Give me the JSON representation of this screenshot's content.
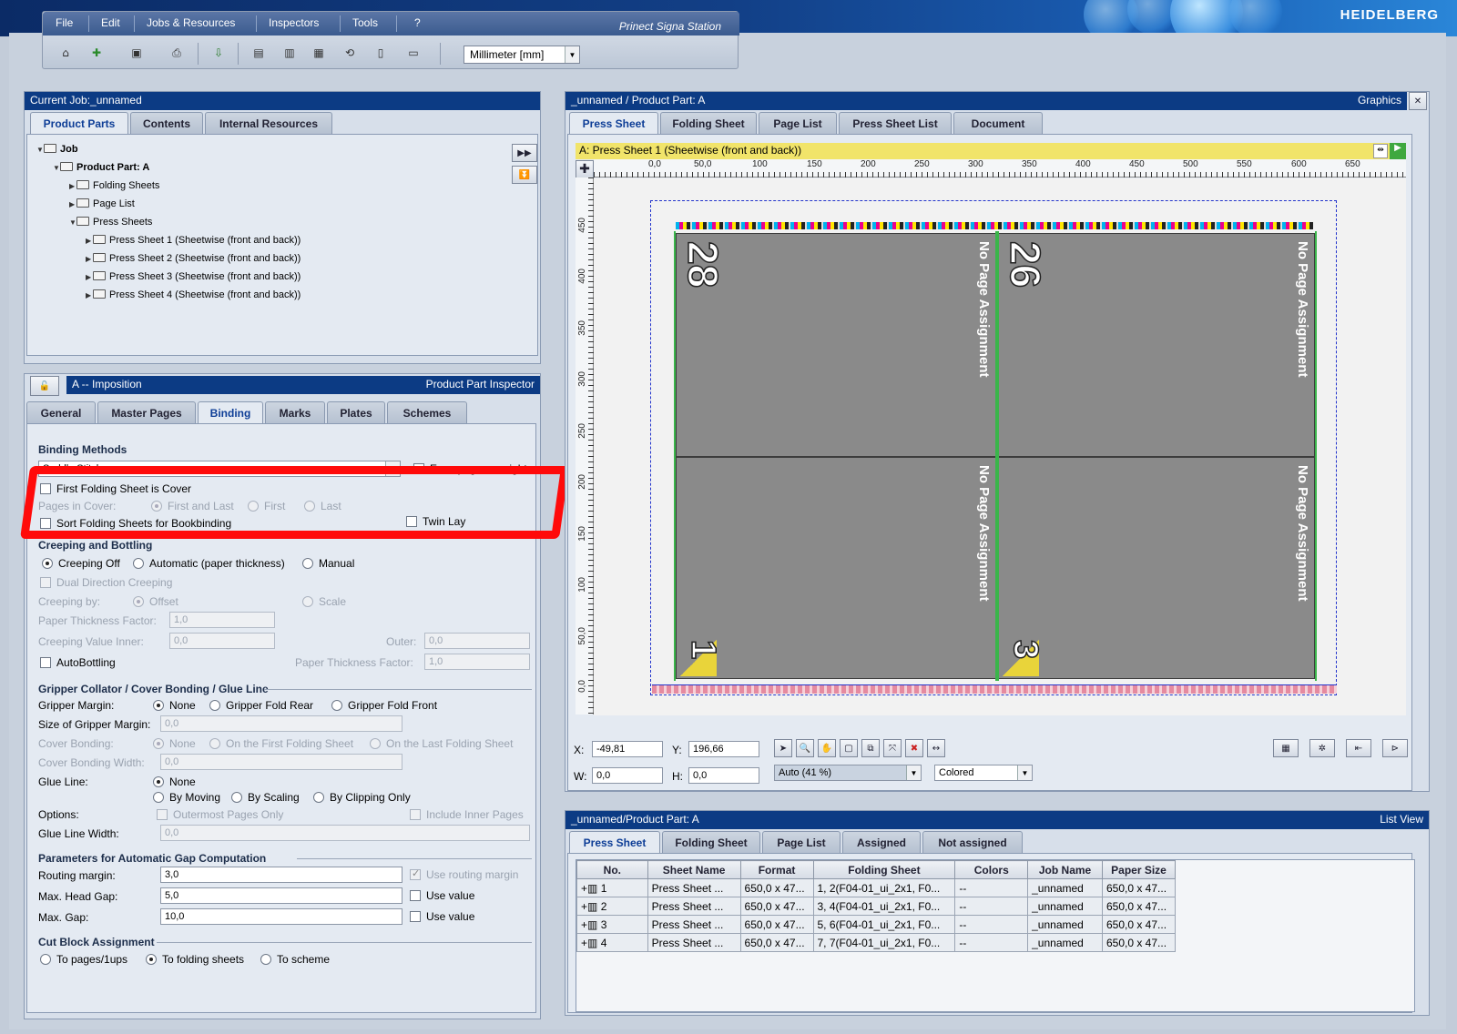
{
  "header": {
    "brand": "HEIDELBERG",
    "app_title": "Prinect Signa Station"
  },
  "menu": [
    "File",
    "Edit",
    "Jobs & Resources",
    "Inspectors",
    "Tools",
    "?"
  ],
  "toolbar": {
    "units": "Millimeter  [mm]"
  },
  "job_panel": {
    "title": "Current Job:_unnamed",
    "tabs": [
      "Product Parts",
      "Contents",
      "Internal Resources"
    ],
    "tree": {
      "job": "Job",
      "product_part": "Product Part: A",
      "folding_sheets": "Folding Sheets",
      "page_list": "Page List",
      "press_sheets": "Press Sheets",
      "sheets": [
        "Press Sheet 1 (Sheetwise (front and back))",
        "Press Sheet 2 (Sheetwise (front and back))",
        "Press Sheet 3 (Sheetwise (front and back))",
        "Press Sheet 4 (Sheetwise (front and back))"
      ]
    }
  },
  "inspector": {
    "title_left": "A -- Imposition",
    "title_right": "Product Part Inspector",
    "tabs": [
      "General",
      "Master Pages",
      "Binding",
      "Marks",
      "Plates",
      "Schemes"
    ],
    "binding_methods": "Binding Methods",
    "binding_value": "Saddle Stitch",
    "even_pages": "Even pages on right",
    "first_folding_cover": "First Folding Sheet is Cover",
    "pages_in_cover": "Pages in Cover:",
    "cover_opts": [
      "First and Last",
      "First",
      "Last"
    ],
    "sort_folding": "Sort Folding Sheets for Bookbinding",
    "twin_lay": "Twin Lay",
    "creeping_header": "Creeping and Bottling",
    "creeping_opts": [
      "Creeping Off",
      "Automatic (paper thickness)",
      "Manual"
    ],
    "dual_direction": "Dual Direction Creeping",
    "creeping_by": "Creeping by:",
    "creeping_by_opts": [
      "Offset",
      "Scale"
    ],
    "paper_thickness_factor": "Paper Thickness Factor:",
    "ptf_value": "1,0",
    "creeping_value_inner": "Creeping Value Inner:",
    "cvi_value": "0,0",
    "outer": "Outer:",
    "outer_value": "0,0",
    "autobottling": "AutoBottling",
    "ptf2_label": "Paper Thickness Factor:",
    "ptf2_value": "1,0",
    "gripper_header": "Gripper Collator / Cover Bonding / Glue Line",
    "gripper_margin": "Gripper Margin:",
    "gripper_opts": [
      "None",
      "Gripper Fold Rear",
      "Gripper Fold Front"
    ],
    "size_gripper": "Size of Gripper Margin:",
    "size_gripper_value": "0,0",
    "cover_bonding": "Cover Bonding:",
    "cover_bonding_opts": [
      "None",
      "On the First Folding Sheet",
      "On the Last Folding Sheet"
    ],
    "cover_bonding_width": "Cover Bonding Width:",
    "cbw_value": "0,0",
    "glue_line": "Glue Line:",
    "glue_opts": [
      "None",
      "By Moving",
      "By Scaling",
      "By Clipping Only"
    ],
    "options": "Options:",
    "outermost": "Outermost Pages Only",
    "include_inner": "Include Inner Pages",
    "glue_line_width": "Glue Line Width:",
    "glw_value": "0,0",
    "params_header": "Parameters for Automatic Gap Computation",
    "routing_margin": "Routing margin:",
    "routing_value": "3,0",
    "use_routing": "Use routing margin",
    "max_head_gap": "Max. Head Gap:",
    "mhg_value": "5,0",
    "use_value": "Use value",
    "max_gap": "Max. Gap:",
    "mg_value": "10,0",
    "use_value2": "Use value",
    "cut_header": "Cut Block Assignment",
    "cut_opts": [
      "To pages/1ups",
      "To folding sheets",
      "To scheme"
    ]
  },
  "graphics": {
    "title": "_unnamed / Product Part: A",
    "title_right": "Graphics",
    "tabs": [
      "Press Sheet",
      "Folding Sheet",
      "Page List",
      "Press Sheet List",
      "Document"
    ],
    "sheet_label": "A:  Press Sheet 1 (Sheetwise (front and back))",
    "ruler_x": [
      "0,0",
      "50,0",
      "100",
      "150",
      "200",
      "250",
      "300",
      "350",
      "400",
      "450",
      "500",
      "550",
      "600",
      "650"
    ],
    "ruler_y": [
      "450",
      "400",
      "350",
      "300",
      "250",
      "200",
      "150",
      "100",
      "50,0",
      "0,0"
    ],
    "pages": [
      {
        "num": "28",
        "label": "No Page Assignment"
      },
      {
        "num": "26",
        "label": "No Page Assignment"
      },
      {
        "num": "",
        "label": "No Page Assignment"
      },
      {
        "num": "",
        "label": "No Page Assignment"
      }
    ],
    "bottom_nums": [
      "1",
      "3"
    ],
    "x_label": "X:",
    "x_value": "-49,81",
    "y_label": "Y:",
    "y_value": "196,66",
    "w_label": "W:",
    "w_value": "0,0",
    "h_label": "H:",
    "h_value": "0,0",
    "zoom": "Auto (41 %)",
    "color_mode": "Colored"
  },
  "listview": {
    "title": "_unnamed/Product Part: A",
    "title_right": "List View",
    "tabs": [
      "Press Sheet",
      "Folding Sheet",
      "Page List",
      "Assigned",
      "Not assigned"
    ],
    "columns": [
      "No.",
      "Sheet Name",
      "Format",
      "Folding Sheet",
      "Colors",
      "Job Name",
      "Paper Size"
    ],
    "rows": [
      [
        "1",
        "Press Sheet ...",
        "650,0 x 47...",
        "1, 2(F04-01_ui_2x1, F0...",
        "--",
        "_unnamed",
        "650,0 x 47..."
      ],
      [
        "2",
        "Press Sheet ...",
        "650,0 x 47...",
        "3, 4(F04-01_ui_2x1, F0...",
        "--",
        "_unnamed",
        "650,0 x 47..."
      ],
      [
        "3",
        "Press Sheet ...",
        "650,0 x 47...",
        "5, 6(F04-01_ui_2x1, F0...",
        "--",
        "_unnamed",
        "650,0 x 47..."
      ],
      [
        "4",
        "Press Sheet ...",
        "650,0 x 47...",
        "7, 7(F04-01_ui_2x1, F0...",
        "--",
        "_unnamed",
        "650,0 x 47..."
      ]
    ]
  }
}
